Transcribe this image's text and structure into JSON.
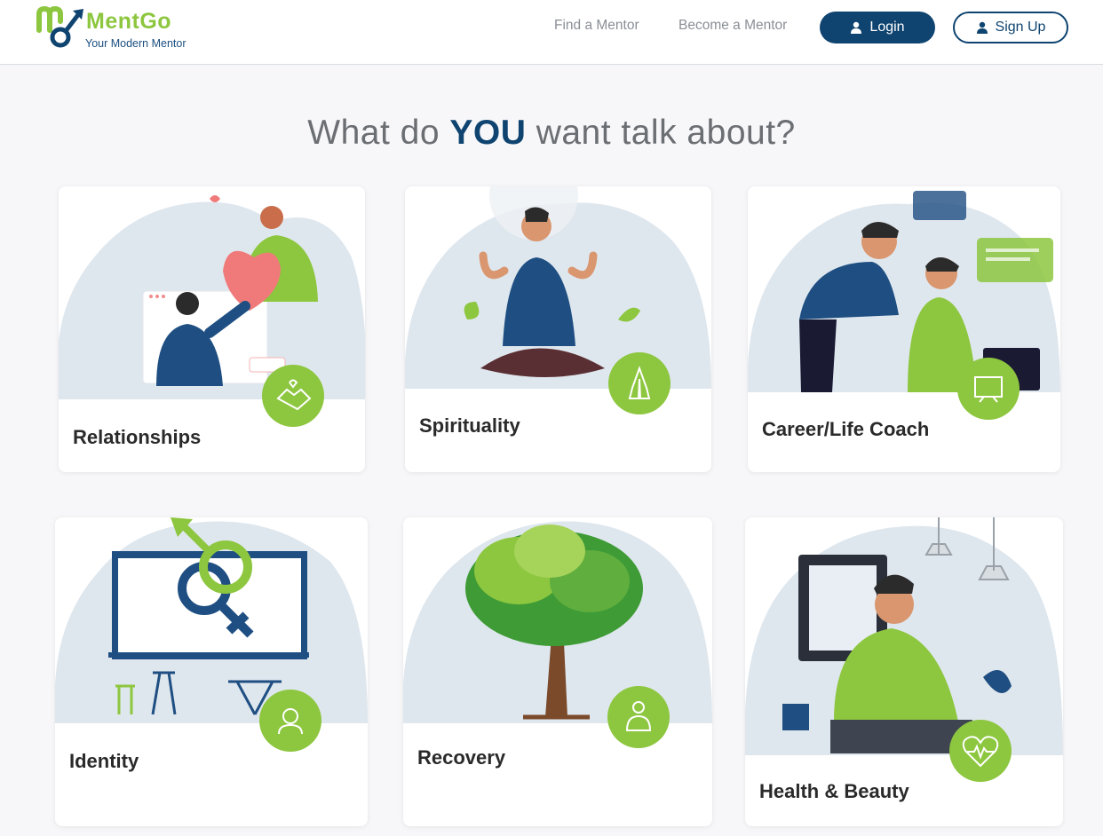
{
  "brand": {
    "name": "MentGo",
    "tagline": "Your Modern Mentor"
  },
  "nav": {
    "find_mentor": "Find a Mentor",
    "become_mentor": "Become a Mentor",
    "login": "Login",
    "signup": "Sign Up"
  },
  "heading": {
    "part1": "What do ",
    "emphasis": "YOU",
    "part2": " want talk about?"
  },
  "categories": [
    {
      "title": "Relationships",
      "icon": "handshake-heart-icon"
    },
    {
      "title": "Spirituality",
      "icon": "praying-hands-icon"
    },
    {
      "title": "Career/Life Coach",
      "icon": "presentation-board-icon"
    },
    {
      "title": "Identity",
      "icon": "person-question-icon"
    },
    {
      "title": "Recovery",
      "icon": "hug-support-icon"
    },
    {
      "title": "Health & Beauty",
      "icon": "heartbeat-icon"
    }
  ],
  "colors": {
    "brand_navy": "#0f4470",
    "brand_green": "#8dc63f",
    "blob": "#dfe7ee"
  }
}
